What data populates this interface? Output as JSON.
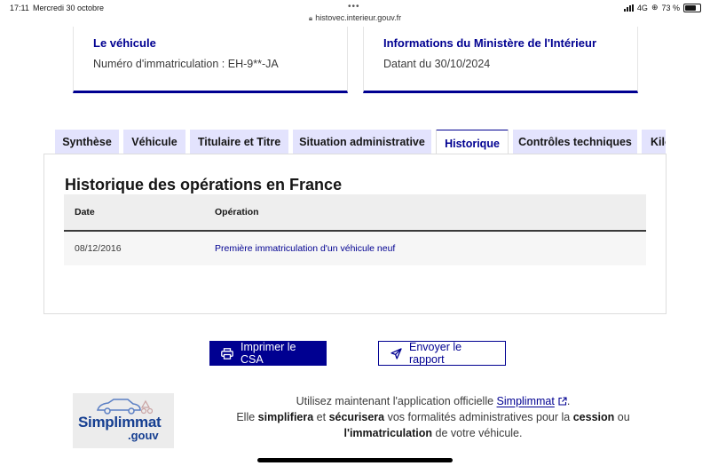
{
  "status_bar": {
    "time": "17:11",
    "date": "Mercredi 30 octobre",
    "url": "histovec.interieur.gouv.fr",
    "network": "4G",
    "battery": "73 %",
    "lock_icon": "lock-icon"
  },
  "vehicle_card": {
    "title": "Le véhicule",
    "text": "Numéro d'immatriculation : EH-9**-JA"
  },
  "ministry_card": {
    "title": "Informations du Ministère de l'Intérieur",
    "text": "Datant du 30/10/2024"
  },
  "tabs": [
    {
      "label": "Synthèse"
    },
    {
      "label": "Véhicule"
    },
    {
      "label": "Titulaire et Titre"
    },
    {
      "label": "Situation administrative"
    },
    {
      "label": "Historique"
    },
    {
      "label": "Contrôles techniques"
    },
    {
      "label": "Kilométrage"
    }
  ],
  "active_tab": "Historique",
  "history": {
    "title": "Historique des opérations en France",
    "columns": [
      "Date",
      "Opération"
    ],
    "rows": [
      {
        "date": "08/12/2016",
        "operation": "Première immatriculation d'un véhicule neuf"
      }
    ]
  },
  "actions": {
    "print_label": "Imprimer le CSA",
    "send_label": "Envoyer le rapport",
    "print_icon": "printer-icon",
    "send_icon": "send-icon"
  },
  "promo": {
    "logo_text": "Simplimmat",
    "logo_suffix": ".gouv",
    "line1_prefix": "Utilisez maintenant l'application officielle ",
    "link": "Simplimmat",
    "line1_suffix": ".",
    "line2_a": "Elle ",
    "line2_b": "simplifiera",
    "line2_c": " et ",
    "line2_d": "sécurisera",
    "line2_e": " vos formalités administratives pour la ",
    "line2_f": "cession",
    "line2_g": " ou",
    "line3_a": "l'immatriculation",
    "line3_b": " de votre véhicule."
  },
  "colors": {
    "brand_blue": "#000091",
    "tab_bg": "#e3e3fd",
    "logo_red": "#e1000f"
  }
}
